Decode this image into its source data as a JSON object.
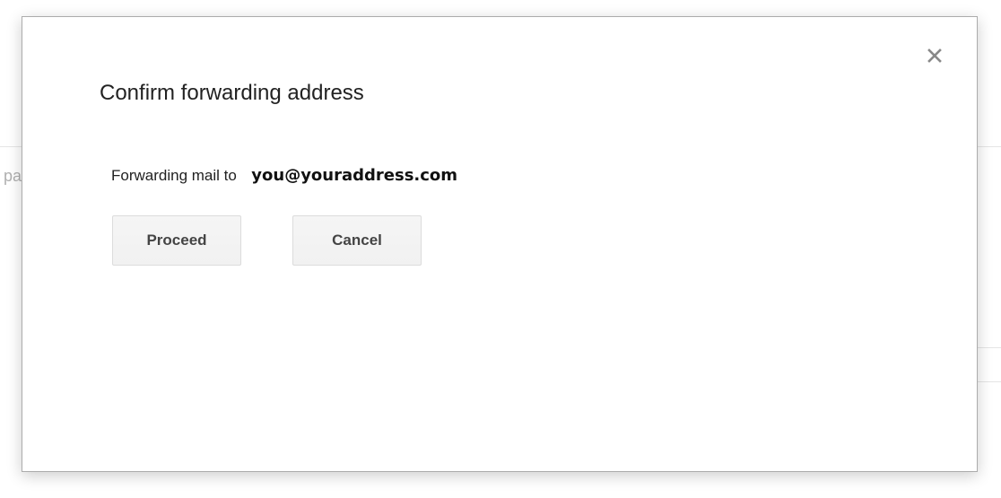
{
  "background": {
    "partial_text": "pa"
  },
  "dialog": {
    "title": "Confirm forwarding address",
    "forwarding_label": "Forwarding mail to",
    "forwarding_address": "you@youraddress.com",
    "proceed_label": "Proceed",
    "cancel_label": "Cancel",
    "close_icon": "close-icon"
  },
  "colors": {
    "dialog_border": "#acacac",
    "button_background": "#f5f5f5",
    "button_border": "#dcdcdc",
    "button_text": "#444444",
    "close_icon": "#888888",
    "title_text": "#222222"
  }
}
